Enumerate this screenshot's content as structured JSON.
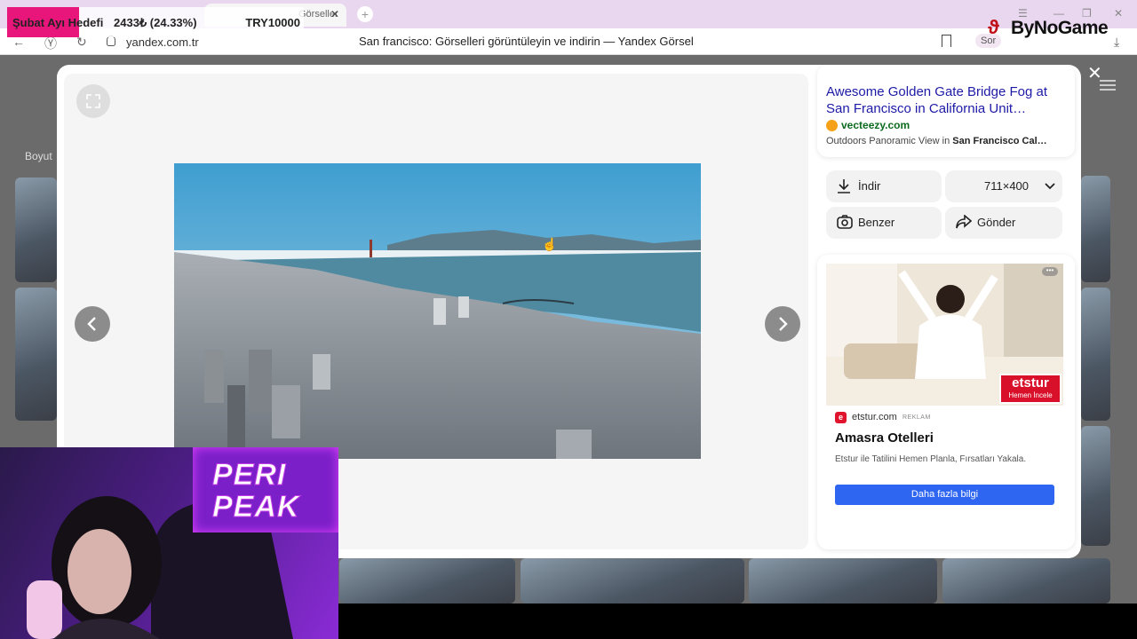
{
  "browser": {
    "tab_title": "Görseller",
    "url": "yandex.com.tr",
    "page_title": "San francisco: Görselleri görüntüleyin ve indirin — Yandex Görsel",
    "sor_label": "Sor"
  },
  "overlay": {
    "goal_label": "Şubat Ayı Hedefi",
    "goal_amount": "2433₺ (24.33%)",
    "goal_target": "TRY10000",
    "goal_progress_pct": 24.33,
    "goal_color": "#e8157a",
    "channel_logo": "ByNoGame",
    "streamer_name_line1": "PERI",
    "streamer_name_line2": "PEAK"
  },
  "background_page": {
    "filter_label": "Boyut"
  },
  "result": {
    "title": "Awesome Golden Gate Bridge Fog at San Francisco in California Unit…",
    "source": "vecteezy.com",
    "description_prefix": "Outdoors Panoramic View in ",
    "description_bold": "San Francisco Cal…",
    "download_label": "İndir",
    "size_label": "711×400",
    "similar_label": "Benzer",
    "send_label": "Gönder"
  },
  "ad": {
    "brand_logo": "etstur",
    "brand_cta": "Hemen İncele",
    "domain": "etstur.com",
    "tag": "REKLAM",
    "title": "Amasra Otelleri",
    "text": "Etstur ile Tatilini Hemen Planla, Fırsatları Yakala.",
    "button": "Daha fazla bilgi",
    "button_color": "#2f66f1"
  },
  "icons": [
    "expand-icon",
    "chevron-left-icon",
    "chevron-right-icon",
    "download-icon",
    "chevron-down-icon",
    "camera-search-icon",
    "share-icon",
    "close-icon",
    "lock-icon",
    "bookmark-icon"
  ]
}
